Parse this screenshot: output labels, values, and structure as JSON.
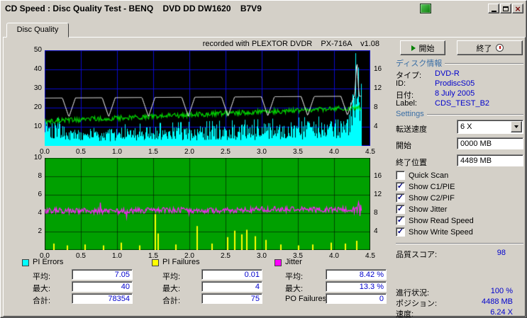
{
  "window": {
    "title": "CD Speed : Disc Quality Test - BENQ    DVD DD DW1620    B7V9"
  },
  "tab": {
    "label": "Disc Quality"
  },
  "chart_header": {
    "recorded_with": "recorded with PLEXTOR DVDR    PX-716A    v1.08"
  },
  "controls": {
    "start_label": "開始",
    "exit_label": "終了"
  },
  "disc_info": {
    "header": "ディスク情報",
    "rows": [
      {
        "label": "タイプ:",
        "value": "DVD-R"
      },
      {
        "label": "ID:",
        "value": "ProdiscS05"
      },
      {
        "label": "日付:",
        "value": "8 July 2005"
      },
      {
        "label": "Label:",
        "value": "CDS_TEST_B2"
      }
    ]
  },
  "settings": {
    "header": "Settings",
    "speed_label": "転送速度",
    "speed_value": "6 X",
    "start_label": "開始",
    "start_value": "0000 MB",
    "end_label": "終了位置",
    "end_value": "4489 MB",
    "checkboxes": [
      {
        "label": "Quick Scan",
        "checked": false
      },
      {
        "label": "Show C1/PIE",
        "checked": true
      },
      {
        "label": "Show C2/PIF",
        "checked": true
      },
      {
        "label": "Show Jitter",
        "checked": true
      },
      {
        "label": "Show Read Speed",
        "checked": true
      },
      {
        "label": "Show Write Speed",
        "checked": true
      }
    ]
  },
  "quality": {
    "label": "品質スコア:",
    "value": "98"
  },
  "status": {
    "rows": [
      {
        "label": "進行状況:",
        "value": "100 %"
      },
      {
        "label": "ポジション:",
        "value": "4488 MB"
      },
      {
        "label": "速度:",
        "value": "6.24 X"
      }
    ]
  },
  "stats": {
    "groups": [
      {
        "name": "PI Errors",
        "color": "#00FFFF",
        "rows": [
          {
            "label": "平均:",
            "value": "7.05"
          },
          {
            "label": "最大:",
            "value": "40"
          },
          {
            "label": "合計:",
            "value": "78354"
          }
        ]
      },
      {
        "name": "PI Failures",
        "color": "#FFFF00",
        "rows": [
          {
            "label": "平均:",
            "value": "0.01"
          },
          {
            "label": "最大:",
            "value": "4"
          },
          {
            "label": "合計:",
            "value": "75"
          }
        ]
      },
      {
        "name": "Jitter",
        "color": "#FF00FF",
        "rows": [
          {
            "label": "平均:",
            "value": "8.42 %"
          },
          {
            "label": "最大:",
            "value": "13.3 %"
          },
          {
            "label": "PO Failures:",
            "value": "0"
          }
        ]
      }
    ]
  },
  "chart_data": [
    {
      "type": "area",
      "name": "pi-errors-and-speed",
      "x_range": [
        0,
        4.5
      ],
      "data_end_x": 4.38,
      "x_ticks": [
        "0.0",
        "0.5",
        "1.0",
        "1.5",
        "2.0",
        "2.5",
        "3.0",
        "3.5",
        "4.0",
        "4.5"
      ],
      "y_left": {
        "range": [
          0,
          50
        ],
        "ticks": [
          10,
          20,
          30,
          40,
          50
        ]
      },
      "y_right": {
        "ticks": [
          4,
          8,
          12,
          16
        ],
        "at_left_values": [
          10,
          20,
          30,
          40
        ]
      },
      "plot_bg": "#000000",
      "grid_color": "#0A0ACC",
      "series": [
        {
          "name": "PI Errors",
          "color": "#00FFFF",
          "style": "noise-area",
          "keypoints": [
            [
              0,
              17
            ],
            [
              0.1,
              12
            ],
            [
              0.3,
              8
            ],
            [
              1.0,
              8
            ],
            [
              2.0,
              9
            ],
            [
              3.0,
              10
            ],
            [
              3.8,
              11
            ],
            [
              4.1,
              12
            ],
            [
              4.2,
              14
            ],
            [
              4.26,
              30
            ],
            [
              4.31,
              46
            ],
            [
              4.36,
              32
            ],
            [
              4.38,
              18
            ]
          ]
        },
        {
          "name": "Read Speed",
          "color": "#00D400",
          "style": "noisy-line",
          "noise": 1.3,
          "keypoints": [
            [
              0,
              13
            ],
            [
              4.38,
              20
            ]
          ]
        },
        {
          "name": "Write Speed",
          "color": "#FFFFFF",
          "style": "dip-line",
          "keypoints": [
            [
              0,
              25
            ],
            [
              4.38,
              26
            ]
          ],
          "dips": [
            0.33,
            0.88,
            1.43,
            1.98,
            2.53,
            3.08,
            3.63,
            4.18
          ],
          "dip_depth": 10,
          "dip_width": 0.09,
          "end_spike": {
            "x": 4.31,
            "value": 45,
            "width": 0.03
          }
        }
      ]
    },
    {
      "type": "line",
      "name": "jitter-and-pi-failures",
      "x_range": [
        0,
        4.5
      ],
      "data_end_x": 4.38,
      "x_ticks": [
        "0.0",
        "0.5",
        "1.0",
        "1.5",
        "2.0",
        "2.5",
        "3.0",
        "3.5",
        "4.0",
        "4.5"
      ],
      "y_left": {
        "range": [
          0,
          10
        ],
        "ticks": [
          2,
          4,
          6,
          8,
          10
        ]
      },
      "y_right": {
        "ticks": [
          4,
          8,
          12,
          16
        ],
        "at_left_values": [
          2,
          4,
          6,
          8
        ]
      },
      "plot_bg": "#00A000",
      "grid_color": "rgba(0,0,0,0.55)",
      "series": [
        {
          "name": "PI Failures",
          "color": "#FFFF00",
          "style": "spikes",
          "points": [
            [
              0.12,
              0.7
            ],
            [
              0.3,
              0.5
            ],
            [
              0.55,
              0.6
            ],
            [
              0.8,
              0.5
            ],
            [
              1.05,
              0.8
            ],
            [
              1.3,
              0.5
            ],
            [
              1.52,
              3.9
            ],
            [
              1.56,
              1.8
            ],
            [
              1.8,
              0.6
            ],
            [
              2.1,
              2.6
            ],
            [
              2.3,
              0.7
            ],
            [
              2.52,
              1.4
            ],
            [
              2.62,
              2.1
            ],
            [
              2.72,
              1.7
            ],
            [
              2.78,
              2.2
            ],
            [
              2.9,
              1.5
            ],
            [
              3.05,
              1.1
            ],
            [
              3.25,
              0.6
            ],
            [
              3.5,
              0.5
            ],
            [
              3.7,
              0.6
            ],
            [
              3.95,
              0.8
            ],
            [
              4.15,
              0.7
            ],
            [
              4.3,
              1.0
            ]
          ]
        },
        {
          "name": "Jitter",
          "color": "#FF20FF",
          "style": "noisy-line",
          "noise": 0.3,
          "spike_chance": 0.03,
          "spike_size": 0.8,
          "end_noise": {
            "from": 4.25,
            "mult": 2.5
          },
          "keypoints": [
            [
              0,
              4.3
            ],
            [
              1.0,
              4.2
            ],
            [
              1.6,
              4.35
            ],
            [
              2.5,
              4.3
            ],
            [
              3.2,
              4.45
            ],
            [
              4.0,
              4.35
            ],
            [
              4.38,
              4.5
            ]
          ]
        }
      ]
    }
  ]
}
